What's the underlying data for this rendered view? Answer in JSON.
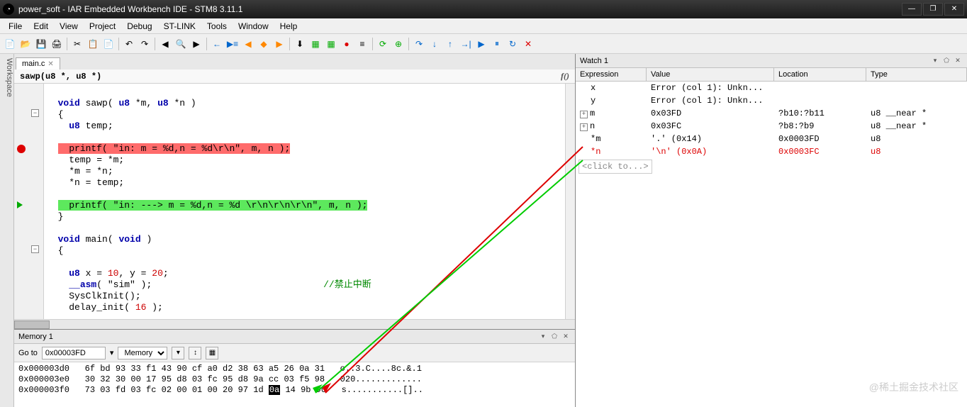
{
  "window": {
    "title": "power_soft - IAR Embedded Workbench IDE - STM8 3.11.1",
    "minimize": "—",
    "maximize": "❐",
    "close": "✕"
  },
  "menu": [
    "File",
    "Edit",
    "View",
    "Project",
    "Debug",
    "ST-LINK",
    "Tools",
    "Window",
    "Help"
  ],
  "sidebar_label": "Workspace",
  "editor": {
    "tab": "main.c",
    "tab_close": "✕",
    "signature": "sawp(u8 *, u8 *)",
    "fx_label": "f()",
    "lines": [
      "",
      "void sawp( u8 *m, u8 *n )",
      "{",
      "  u8 temp;",
      "",
      "  printf( \"in: m = %d,n = %d\\r\\n\", m, n );",
      "  temp = *m;",
      "  *m = *n;",
      "  *n = temp;",
      "",
      "  printf( \"in: ---> m = %d,n = %d \\r\\n\\r\\n\\r\\n\", m, n );",
      "}",
      "",
      "void main( void )",
      "{",
      "",
      "  u8 x = 10, y = 20;",
      "  __asm( \"sim\" );                               //禁止中断",
      "  SysClkInit();",
      "  delay_init( 16 );"
    ]
  },
  "memory": {
    "title": "Memory 1",
    "goto_label": "Go to",
    "goto_value": "0x00003FD",
    "view_value": "Memory",
    "rows": [
      {
        "addr": "0x000003d0",
        "hex": "6f bd 93 33 f1 43 90 cf a0 d2 38 63 a5 26 0a 31",
        "ascii": "o..3.C....8c.&.1"
      },
      {
        "addr": "0x000003e0",
        "hex": "30 32 30 00 17 95 d8 03 fc 95 d8 9a cc 03 f5 98",
        "ascii": "020............."
      },
      {
        "addr": "0x000003f0",
        "hex": "73 03 fd 03 fc 02 00 01 00 20 97 1d 0a 14 9b 90",
        "ascii": "s...........[].."
      }
    ],
    "highlight_byte": "0a"
  },
  "watch": {
    "title": "Watch 1",
    "columns": [
      "Expression",
      "Value",
      "Location",
      "Type"
    ],
    "rows": [
      {
        "exp": "x",
        "val": "Error (col 1): Unkn...",
        "loc": "",
        "typ": "",
        "icon": ""
      },
      {
        "exp": "y",
        "val": "Error (col 1): Unkn...",
        "loc": "",
        "typ": "",
        "icon": ""
      },
      {
        "exp": "m",
        "val": "0x03FD",
        "loc": "?b10:?b11",
        "typ": "u8 __near *",
        "icon": "+"
      },
      {
        "exp": "n",
        "val": "0x03FC",
        "loc": "?b8:?b9",
        "typ": "u8 __near *",
        "icon": "+"
      },
      {
        "exp": "*m",
        "val": "'.' (0x14)",
        "loc": "0x0003FD",
        "typ": "u8",
        "icon": ""
      },
      {
        "exp": "*n",
        "val": "'\\n' (0x0A)",
        "loc": "0x0003FC",
        "typ": "u8",
        "icon": "",
        "red": true
      }
    ],
    "placeholder": "<click to...>"
  },
  "watermark": "@稀土掘金技术社区"
}
